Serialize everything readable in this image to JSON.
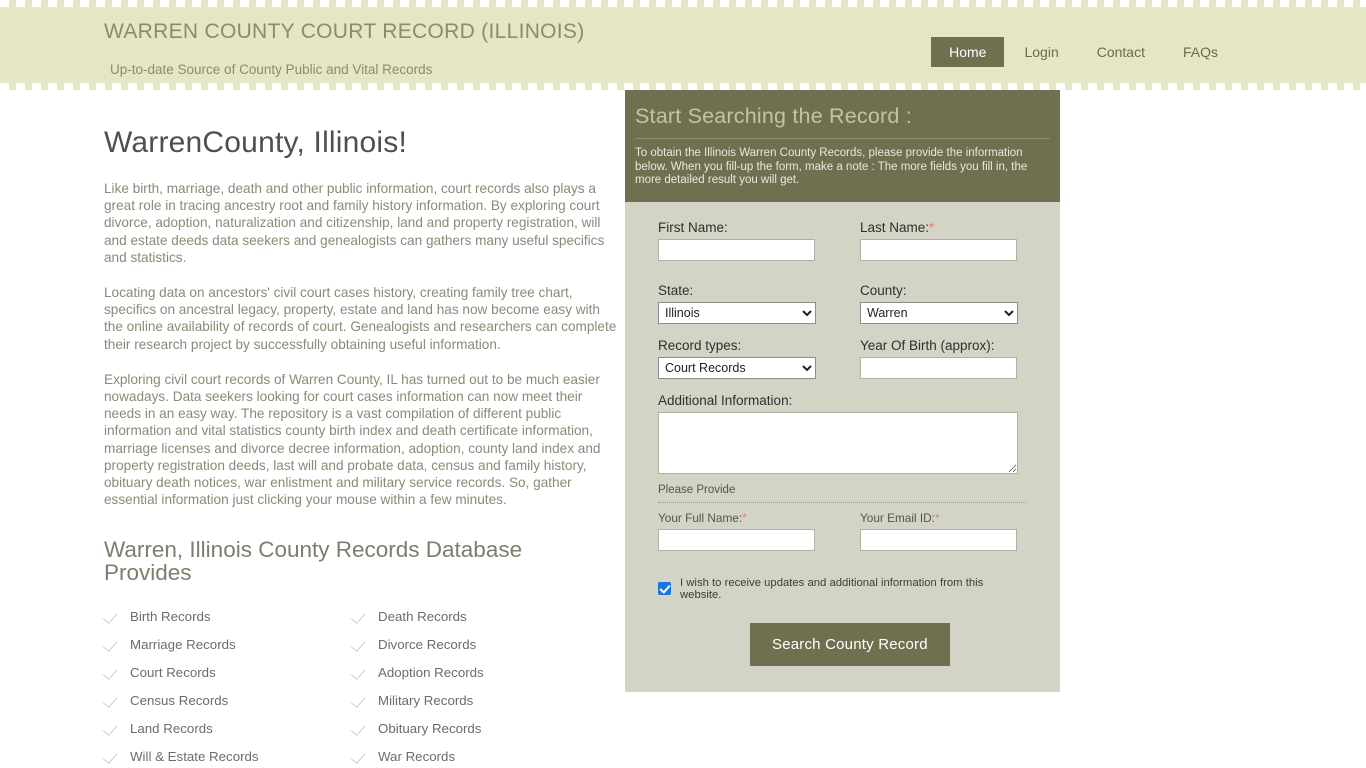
{
  "header": {
    "site_title": "WARREN COUNTY COURT RECORD (ILLINOIS)",
    "tagline": "Up-to-date Source of  County Public and Vital Records",
    "nav": [
      {
        "label": "Home",
        "active": true
      },
      {
        "label": "Login",
        "active": false
      },
      {
        "label": "Contact",
        "active": false
      },
      {
        "label": "FAQs",
        "active": false
      }
    ],
    "colors": {
      "background": "#e5e7c4",
      "text": "#8b8b73",
      "active_nav_bg": "#6f7050"
    }
  },
  "main": {
    "page_title": "WarrenCounty, Illinois!",
    "paragraphs": [
      "Like birth, marriage, death and other public information, court records also plays a great role in tracing ancestry root and family history information. By exploring court divorce, adoption, naturalization and citizenship, land and property registration, will and estate deeds data seekers and genealogists can gathers many useful specifics and statistics.",
      "Locating data on ancestors' civil court cases history, creating family tree chart, specifics on ancestral legacy, property, estate and land has now become easy with the online availability of records of court. Genealogists and researchers can complete their research project by successfully obtaining useful information.",
      "Exploring civil court records of Warren County, IL has turned out to be much easier nowadays. Data seekers looking for court cases information can now meet their needs in an easy way. The repository is a vast compilation of different public information and vital statistics county birth index and death certificate information, marriage licenses and divorce decree information, adoption, county land index and property registration deeds, last will and probate data, census and family history, obituary death notices, war enlistment and military service records. So, gather essential information just clicking your mouse within a few minutes."
    ],
    "section_title": "Warren, Illinois County Records Database Provides",
    "records_left": [
      "Birth Records",
      "Marriage Records",
      "Court Records",
      "Census Records",
      "Land Records",
      "Will & Estate Records"
    ],
    "records_right": [
      "Death Records",
      "Divorce Records",
      "Adoption Records",
      "Military Records",
      "Obituary Records",
      "War Records"
    ],
    "check_icon": "check-icon"
  },
  "form": {
    "title": "Start Searching the Record :",
    "description": "To obtain the Illinois Warren County Records, please provide the information below. When you fill-up the form, make a note : The more fields you fill in, the more detailed result you will get.",
    "first_name": {
      "label": "First Name:",
      "value": "",
      "placeholder": ""
    },
    "last_name": {
      "label": "Last Name:",
      "required_mark": "*",
      "value": "",
      "placeholder": ""
    },
    "state": {
      "label": "State:",
      "value": "Illinois",
      "options": [
        "Illinois"
      ]
    },
    "county": {
      "label": "County:",
      "value": "Warren",
      "options": [
        "Warren"
      ]
    },
    "record_types": {
      "label": "Record types:",
      "value": "Court Records",
      "options": [
        "Court Records"
      ]
    },
    "year_of_birth": {
      "label": "Year Of Birth (approx):",
      "value": "",
      "placeholder": ""
    },
    "additional_information": {
      "label": "Additional Information:",
      "value": "",
      "placeholder": ""
    },
    "please_provide": "Please Provide",
    "full_name": {
      "label": "Your Full Name:",
      "required_mark": "*",
      "value": "",
      "placeholder": ""
    },
    "email_id": {
      "label": "Your Email ID:",
      "required_mark": "*",
      "value": "",
      "placeholder": ""
    },
    "consent": {
      "label": "I wish to receive updates and additional information from this website.",
      "checked": true
    },
    "submit_label": "Search County Record",
    "colors": {
      "panel_bg": "#d3d4c6",
      "header_bg": "#6f7050",
      "button_bg": "#6f7050",
      "required": "#e87b6a",
      "checkbox": "#1a73e8"
    }
  }
}
